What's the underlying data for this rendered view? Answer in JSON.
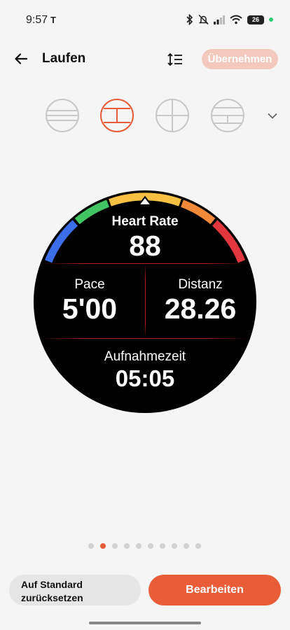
{
  "status_bar": {
    "time": "9:57",
    "battery_level": "26",
    "icons": [
      "tesla-icon",
      "bluetooth-icon",
      "mute-icon",
      "signal-icon",
      "wifi-icon",
      "battery-icon"
    ]
  },
  "header": {
    "title": "Laufen",
    "apply_label": "Übernehmen",
    "apply_enabled": false
  },
  "layouts": {
    "options": [
      "layout-1",
      "layout-2",
      "layout-3",
      "layout-4"
    ],
    "selected_index": 1
  },
  "watch": {
    "heart_rate_label": "Heart Rate",
    "heart_rate_value": "88",
    "pace_label": "Pace",
    "pace_value": "5'00",
    "distance_label": "Distanz",
    "distance_value": "28.26",
    "record_time_label": "Aufnahmezeit",
    "record_time_value": "05:05"
  },
  "pager": {
    "count": 10,
    "active_index": 1
  },
  "footer": {
    "reset_label_line1": "Auf Standard",
    "reset_label_line2": "zurücksetzen",
    "edit_label": "Bearbeiten"
  },
  "colors": {
    "accent": "#e85d37",
    "zone_blue": "#3b6ee8",
    "zone_green": "#43c463",
    "zone_yellow": "#f6c142",
    "zone_orange": "#f08a3a",
    "zone_red": "#e3373f"
  }
}
